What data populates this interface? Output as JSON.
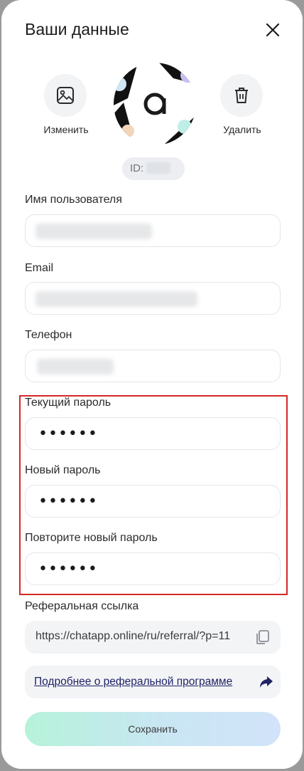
{
  "modal": {
    "title": "Ваши данные"
  },
  "avatar_actions": {
    "change_label": "Изменить",
    "delete_label": "Удалить"
  },
  "user_id": {
    "prefix": "ID:"
  },
  "fields": {
    "username_label": "Имя пользователя",
    "email_label": "Email",
    "phone_label": "Телефон",
    "current_password_label": "Текущий пароль",
    "current_password_value": "••••••",
    "new_password_label": "Новый пароль",
    "new_password_value": "••••••",
    "repeat_password_label": "Повторите новый пароль",
    "repeat_password_value": "••••••"
  },
  "referral": {
    "label": "Реферальная ссылка",
    "url": "https://chatapp.online/ru/referral/?p=11",
    "more_link": "Подробнее о реферальной программе"
  },
  "save_button": "Сохранить",
  "colors": {
    "highlight_border": "#d42828",
    "link": "#1f2366"
  },
  "icons": [
    "close-icon",
    "image-icon",
    "trash-icon",
    "chatapp-logo",
    "copy-icon",
    "share-arrow-icon"
  ]
}
